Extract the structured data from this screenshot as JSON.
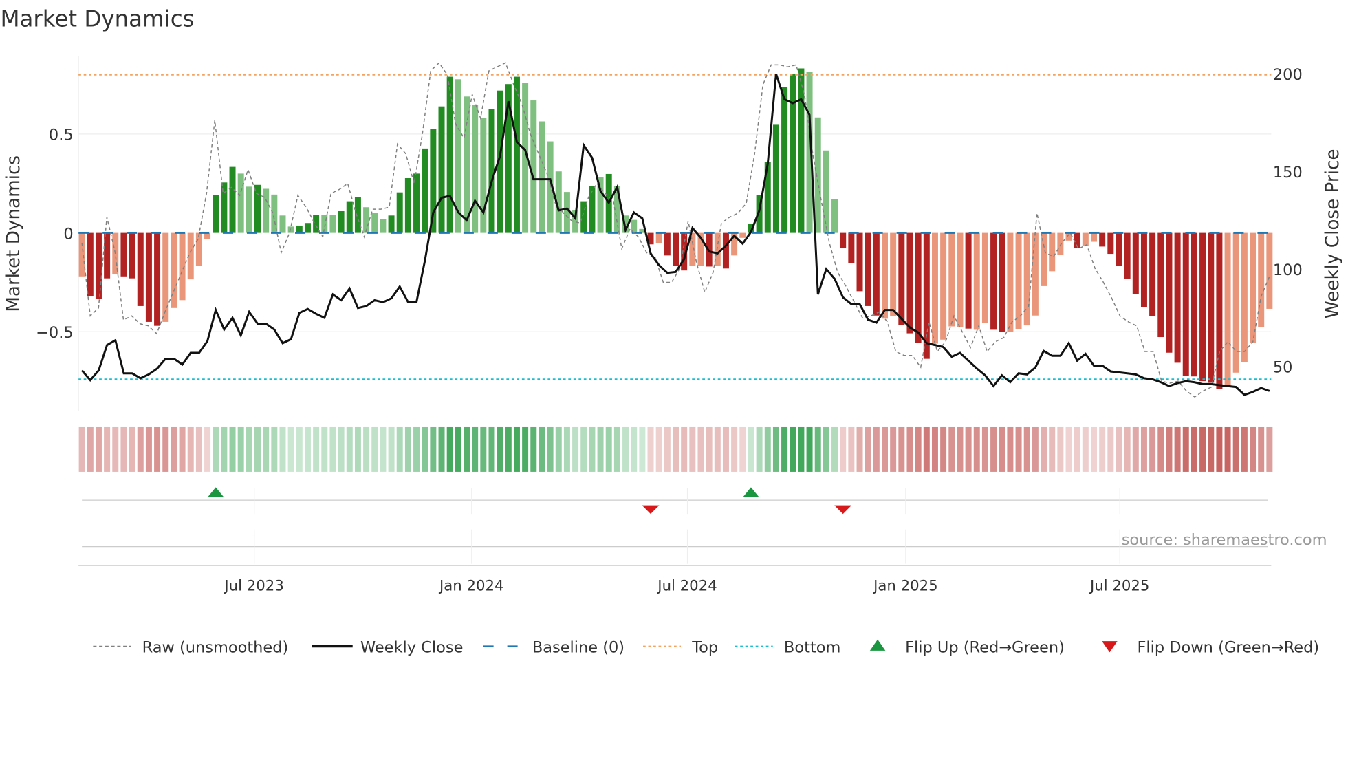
{
  "chart_data": {
    "type": "bar",
    "title": "Market Dynamics",
    "ylabel": "Market Dynamics",
    "y2label": "Weekly Close Price",
    "ylim": [
      -0.94,
      0.92
    ],
    "y2lim": [
      28,
      208
    ],
    "yticks": [
      {
        "v": 0.5,
        "label": "0.5"
      },
      {
        "v": 0,
        "label": "0"
      },
      {
        "v": -0.5,
        "label": "−0.5"
      }
    ],
    "y2ticks": [
      {
        "v": 200,
        "label": "200"
      },
      {
        "v": 150,
        "label": "150"
      },
      {
        "v": 100,
        "label": "100"
      },
      {
        "v": 50,
        "label": "50"
      }
    ],
    "xticks": [
      {
        "week": 20.6,
        "label": "Jul 2023"
      },
      {
        "week": 46.6,
        "label": "Jan 2024"
      },
      {
        "week": 72.4,
        "label": "Jul 2024"
      },
      {
        "week": 98.5,
        "label": "Jan 2025"
      },
      {
        "week": 124.1,
        "label": "Jul 2025"
      }
    ],
    "baseline": 0,
    "top": 0.8,
    "bottom": -0.74,
    "dynamics": [
      -0.22,
      -0.32,
      -0.335,
      -0.23,
      -0.21,
      -0.22,
      -0.23,
      -0.37,
      -0.45,
      -0.47,
      -0.45,
      -0.38,
      -0.34,
      -0.235,
      -0.165,
      -0.03,
      0.19,
      0.255,
      0.334,
      0.3,
      0.234,
      0.243,
      0.223,
      0.194,
      0.088,
      0.032,
      0.037,
      0.05,
      0.09,
      0.09,
      0.09,
      0.11,
      0.16,
      0.18,
      0.13,
      0.1,
      0.07,
      0.088,
      0.205,
      0.277,
      0.3,
      0.427,
      0.524,
      0.64,
      0.79,
      0.777,
      0.69,
      0.649,
      0.582,
      0.628,
      0.72,
      0.753,
      0.79,
      0.758,
      0.67,
      0.564,
      0.463,
      0.311,
      0.207,
      0.114,
      0.16,
      0.237,
      0.282,
      0.298,
      0.237,
      0.088,
      0.066,
      0.02,
      -0.058,
      -0.052,
      -0.114,
      -0.168,
      -0.19,
      -0.165,
      -0.165,
      -0.17,
      -0.168,
      -0.18,
      -0.114,
      -0.025,
      0.045,
      0.19,
      0.36,
      0.547,
      0.737,
      0.803,
      0.832,
      0.816,
      0.584,
      0.417,
      0.17,
      -0.078,
      -0.152,
      -0.295,
      -0.37,
      -0.418,
      -0.434,
      -0.42,
      -0.467,
      -0.508,
      -0.557,
      -0.637,
      -0.56,
      -0.54,
      -0.473,
      -0.477,
      -0.484,
      -0.49,
      -0.457,
      -0.49,
      -0.5,
      -0.5,
      -0.488,
      -0.468,
      -0.418,
      -0.269,
      -0.194,
      -0.112,
      -0.039,
      -0.078,
      -0.065,
      -0.045,
      -0.069,
      -0.106,
      -0.165,
      -0.231,
      -0.309,
      -0.375,
      -0.42,
      -0.527,
      -0.606,
      -0.657,
      -0.723,
      -0.726,
      -0.75,
      -0.758,
      -0.79,
      -0.777,
      -0.707,
      -0.654,
      -0.557,
      -0.477,
      -0.384
    ],
    "rising": [
      1,
      0,
      0,
      0,
      1,
      0,
      0,
      0,
      0,
      0,
      1,
      1,
      1,
      1,
      1,
      1,
      1,
      1,
      1,
      0,
      0,
      1,
      0,
      0,
      0,
      0,
      1,
      1,
      1,
      0,
      0,
      1,
      1,
      1,
      0,
      0,
      0,
      1,
      1,
      1,
      1,
      1,
      1,
      1,
      1,
      0,
      0,
      0,
      0,
      1,
      1,
      1,
      1,
      0,
      0,
      0,
      0,
      0,
      0,
      0,
      1,
      1,
      0,
      1,
      0,
      0,
      0,
      0,
      0,
      1,
      0,
      0,
      0,
      1,
      1,
      0,
      1,
      0,
      1,
      1,
      1,
      1,
      1,
      1,
      1,
      1,
      1,
      0,
      0,
      0,
      0,
      0,
      0,
      0,
      0,
      0,
      1,
      1,
      0,
      0,
      0,
      0,
      1,
      1,
      1,
      1,
      0,
      1,
      1,
      0,
      0,
      1,
      1,
      1,
      1,
      1,
      1,
      1,
      1,
      0,
      1,
      1,
      0,
      0,
      0,
      0,
      0,
      0,
      0,
      0,
      0,
      0,
      0,
      0,
      0,
      0,
      0,
      1,
      1,
      1,
      1,
      1,
      1
    ],
    "raw": [
      -0.05,
      -0.42,
      -0.38,
      0.08,
      -0.1,
      -0.44,
      -0.42,
      -0.46,
      -0.47,
      -0.51,
      -0.4,
      -0.3,
      -0.2,
      -0.1,
      -0.03,
      0.2,
      0.57,
      0.2,
      0.23,
      0.19,
      0.32,
      0.2,
      0.18,
      0.1,
      -0.1,
      0,
      0.19,
      0.13,
      0.05,
      -0.02,
      0.2,
      0.22,
      0.25,
      0.1,
      -0.02,
      0.12,
      0.12,
      0.13,
      0.45,
      0.4,
      0.25,
      0.5,
      0.82,
      0.86,
      0.8,
      0.55,
      0.48,
      0.7,
      0.58,
      0.82,
      0.84,
      0.86,
      0.75,
      0.65,
      0.5,
      0.4,
      0.3,
      0.15,
      0.1,
      0.06,
      0.05,
      0.18,
      0.25,
      0.2,
      0.16,
      -0.08,
      0.02,
      -0.02,
      -0.1,
      -0.12,
      -0.25,
      -0.25,
      -0.18,
      0.06,
      -0.15,
      -0.3,
      -0.2,
      0.05,
      0.08,
      0.1,
      0.15,
      0.4,
      0.75,
      0.85,
      0.85,
      0.84,
      0.85,
      0.7,
      0.4,
      0.17,
      -0.05,
      -0.2,
      -0.27,
      -0.35,
      -0.43,
      -0.42,
      -0.4,
      -0.45,
      -0.6,
      -0.62,
      -0.62,
      -0.68,
      -0.45,
      -0.6,
      -0.55,
      -0.42,
      -0.5,
      -0.58,
      -0.47,
      -0.6,
      -0.55,
      -0.53,
      -0.45,
      -0.42,
      -0.37,
      0.1,
      -0.1,
      -0.12,
      -0.05,
      0,
      -0.08,
      -0.06,
      -0.18,
      -0.25,
      -0.33,
      -0.42,
      -0.45,
      -0.47,
      -0.6,
      -0.6,
      -0.75,
      -0.76,
      -0.75,
      -0.8,
      -0.83,
      -0.8,
      -0.78,
      -0.6,
      -0.55,
      -0.6,
      -0.6,
      -0.55,
      -0.32,
      -0.22
    ],
    "close": [
      48,
      43,
      48,
      61,
      63.5,
      46.5,
      46.5,
      44,
      46,
      49,
      54,
      54,
      51,
      57,
      57,
      63,
      79,
      69,
      75,
      66,
      78,
      72,
      72,
      69,
      62,
      64,
      77.5,
      79.5,
      77,
      75,
      87,
      84,
      90,
      80,
      81,
      84,
      83,
      85,
      91,
      83,
      83,
      104,
      129,
      136.5,
      137.5,
      129,
      125,
      135,
      129,
      145,
      158,
      186,
      165,
      161,
      146,
      146,
      146,
      130,
      131,
      126,
      163.5,
      157,
      140,
      134,
      142,
      120,
      129,
      126,
      108,
      102,
      98,
      98.5,
      105,
      121,
      116,
      109,
      108,
      112,
      117,
      113,
      119,
      130,
      154,
      200,
      187,
      185,
      187,
      179,
      87,
      100,
      95,
      85.5,
      82,
      82,
      74,
      72.5,
      79,
      79,
      74.5,
      70,
      67.5,
      62,
      61,
      60,
      55,
      57,
      53,
      49,
      45.5,
      40,
      45.5,
      42,
      46.5,
      46,
      49.5,
      58,
      55.5,
      55.5,
      62,
      53,
      56.5,
      50.5,
      50.5,
      47.5,
      47,
      46.5,
      46,
      44,
      43.5,
      42,
      40,
      41.5,
      42.5,
      42,
      41,
      41,
      40.5,
      40,
      39.5,
      35.5,
      37,
      39,
      37.5
    ],
    "flips": [
      {
        "week": 16,
        "dir": "up"
      },
      {
        "week": 68,
        "dir": "down"
      },
      {
        "week": 80,
        "dir": "up"
      },
      {
        "week": 91,
        "dir": "down"
      }
    ],
    "legend": [
      {
        "key": "raw",
        "label": "Raw (unsmoothed)"
      },
      {
        "key": "close",
        "label": "Weekly Close"
      },
      {
        "key": "baseline",
        "label": "Baseline (0)"
      },
      {
        "key": "top",
        "label": "Top"
      },
      {
        "key": "bottom",
        "label": "Bottom"
      },
      {
        "key": "flipup",
        "label": "Flip Up (Red→Green)"
      },
      {
        "key": "flipdown",
        "label": "Flip Down (Green→Red)"
      }
    ],
    "legend_placement": "bottom",
    "source": "source: sharemaestro.com",
    "colors": {
      "green_strong": "#228b22",
      "green_soft": "#7fbf7f",
      "red_strong": "#b22222",
      "red_soft": "#e9967a",
      "baseline": "#1f77b4",
      "top": "#f4a460",
      "bottom": "#17becf",
      "flip_up": "#1a9641",
      "flip_down": "#d7191c",
      "raw": "#808080",
      "close": "#111111"
    }
  }
}
